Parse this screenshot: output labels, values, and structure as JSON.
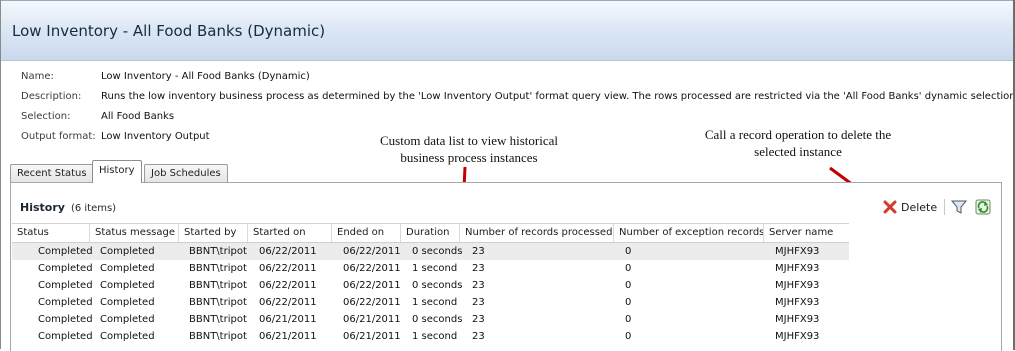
{
  "header": {
    "title": "Low Inventory  - All Food Banks (Dynamic)"
  },
  "details": [
    {
      "label": "Name:",
      "value": "Low Inventory  - All Food Banks (Dynamic)"
    },
    {
      "label": "Description:",
      "value": "Runs the low inventory business process as determined by the 'Low Inventory Output' format query view.  The rows processed are restricted via the 'All Food Banks' dynamic selection."
    },
    {
      "label": "Selection:",
      "value": "All Food Banks"
    },
    {
      "label": "Output format:",
      "value": "Low Inventory Output"
    }
  ],
  "annotations": {
    "datalist_line1": "Custom data list to view historical",
    "datalist_line2": "business process instances",
    "delete_line1": "Call a record operation to delete the",
    "delete_line2": "selected instance"
  },
  "tabs": [
    {
      "label": "Recent Status"
    },
    {
      "label": "History",
      "active": true
    },
    {
      "label": "Job Schedules"
    }
  ],
  "history": {
    "title": "History",
    "count": "(6 items)",
    "delete_label": "Delete",
    "columns": [
      "Status",
      "Status message",
      "Started by",
      "Started on",
      "Ended on",
      "Duration",
      "Number of records processed",
      "Number of exception records",
      "Server name"
    ],
    "rows": [
      [
        "Completed",
        "Completed",
        "BBNT\\tripot",
        "06/22/2011",
        "06/22/2011",
        "0 seconds",
        "23",
        "0",
        "MJHFX93"
      ],
      [
        "Completed",
        "Completed",
        "BBNT\\tripot",
        "06/22/2011",
        "06/22/2011",
        "1 second",
        "23",
        "0",
        "MJHFX93"
      ],
      [
        "Completed",
        "Completed",
        "BBNT\\tripot",
        "06/22/2011",
        "06/22/2011",
        "0 seconds",
        "23",
        "0",
        "MJHFX93"
      ],
      [
        "Completed",
        "Completed",
        "BBNT\\tripot",
        "06/22/2011",
        "06/22/2011",
        "1 second",
        "23",
        "0",
        "MJHFX93"
      ],
      [
        "Completed",
        "Completed",
        "BBNT\\tripot",
        "06/21/2011",
        "06/21/2011",
        "0 seconds",
        "23",
        "0",
        "MJHFX93"
      ],
      [
        "Completed",
        "Completed",
        "BBNT\\tripot",
        "06/21/2011",
        "06/21/2011",
        "1 second",
        "23",
        "0",
        "MJHFX93"
      ]
    ]
  },
  "colors": {
    "header_bg": "#c9d9ee",
    "arrow": "#c00000",
    "delete_icon": "#d33a2c",
    "selected_row": "#ececec"
  },
  "icons": {
    "delete": "delete-x-icon",
    "filter": "filter-funnel-icon",
    "refresh": "refresh-icon"
  }
}
